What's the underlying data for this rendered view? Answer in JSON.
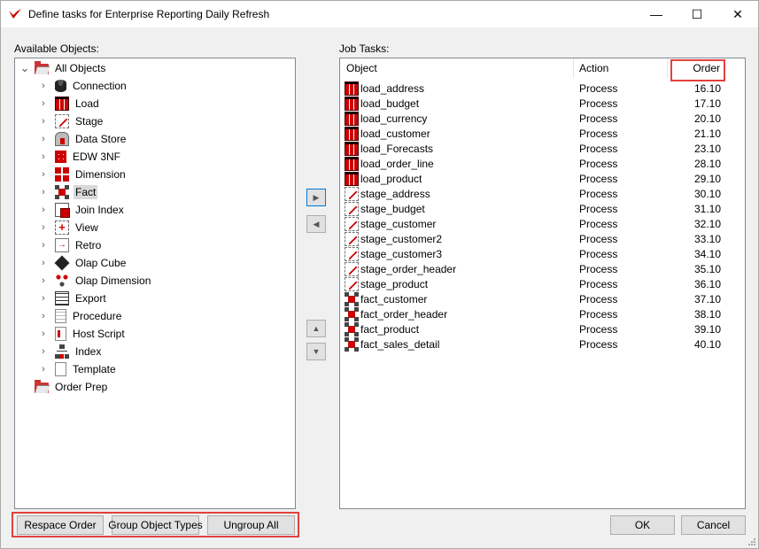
{
  "window": {
    "title": "Define tasks for Enterprise Reporting Daily Refresh",
    "minimize_glyph": "—",
    "maximize_glyph": "☐",
    "close_glyph": "✕"
  },
  "available": {
    "label": "Available Objects:",
    "root": {
      "label": "All Objects",
      "expander": "⌄",
      "icon": "folder-icon"
    },
    "items": [
      {
        "label": "Connection",
        "icon": "database-icon"
      },
      {
        "label": "Load",
        "icon": "load-table-icon"
      },
      {
        "label": "Stage",
        "icon": "stage-table-icon"
      },
      {
        "label": "Data Store",
        "icon": "data-store-icon"
      },
      {
        "label": "EDW 3NF",
        "icon": "edw-icon"
      },
      {
        "label": "Dimension",
        "icon": "dimension-icon"
      },
      {
        "label": "Fact",
        "icon": "fact-icon",
        "selected": true
      },
      {
        "label": "Join Index",
        "icon": "join-index-icon"
      },
      {
        "label": "View",
        "icon": "view-icon"
      },
      {
        "label": "Retro",
        "icon": "retro-icon"
      },
      {
        "label": "Olap Cube",
        "icon": "olap-cube-icon"
      },
      {
        "label": "Olap Dimension",
        "icon": "olap-dimension-icon"
      },
      {
        "label": "Export",
        "icon": "export-icon"
      },
      {
        "label": "Procedure",
        "icon": "procedure-icon"
      },
      {
        "label": "Host Script",
        "icon": "host-script-icon"
      },
      {
        "label": "Index",
        "icon": "index-icon"
      },
      {
        "label": "Template",
        "icon": "template-icon"
      }
    ],
    "order_prep": {
      "label": "Order Prep",
      "icon": "folder-icon"
    },
    "expander_glyph": "›"
  },
  "move_buttons": {
    "add_glyph": "▶",
    "remove_glyph": "◀",
    "up_glyph": "▲",
    "down_glyph": "▼"
  },
  "job": {
    "label": "Job Tasks:",
    "columns": {
      "object": "Object",
      "action": "Action",
      "order": "Order"
    },
    "rows": [
      {
        "object": "load_address",
        "action": "Process",
        "order": "16.10",
        "icon": "load-table-icon"
      },
      {
        "object": "load_budget",
        "action": "Process",
        "order": "17.10",
        "icon": "load-table-icon"
      },
      {
        "object": "load_currency",
        "action": "Process",
        "order": "20.10",
        "icon": "load-table-icon"
      },
      {
        "object": "load_customer",
        "action": "Process",
        "order": "21.10",
        "icon": "load-table-icon"
      },
      {
        "object": "load_Forecasts",
        "action": "Process",
        "order": "23.10",
        "icon": "load-table-icon"
      },
      {
        "object": "load_order_line",
        "action": "Process",
        "order": "28.10",
        "icon": "load-table-icon"
      },
      {
        "object": "load_product",
        "action": "Process",
        "order": "29.10",
        "icon": "load-table-icon"
      },
      {
        "object": "stage_address",
        "action": "Process",
        "order": "30.10",
        "icon": "stage-table-icon"
      },
      {
        "object": "stage_budget",
        "action": "Process",
        "order": "31.10",
        "icon": "stage-table-icon"
      },
      {
        "object": "stage_customer",
        "action": "Process",
        "order": "32.10",
        "icon": "stage-table-icon"
      },
      {
        "object": "stage_customer2",
        "action": "Process",
        "order": "33.10",
        "icon": "stage-table-icon"
      },
      {
        "object": "stage_customer3",
        "action": "Process",
        "order": "34.10",
        "icon": "stage-table-icon"
      },
      {
        "object": "stage_order_header",
        "action": "Process",
        "order": "35.10",
        "icon": "stage-table-icon"
      },
      {
        "object": "stage_product",
        "action": "Process",
        "order": "36.10",
        "icon": "stage-table-icon"
      },
      {
        "object": "fact_customer",
        "action": "Process",
        "order": "37.10",
        "icon": "fact-icon"
      },
      {
        "object": "fact_order_header",
        "action": "Process",
        "order": "38.10",
        "icon": "fact-icon"
      },
      {
        "object": "fact_product",
        "action": "Process",
        "order": "39.10",
        "icon": "fact-icon"
      },
      {
        "object": "fact_sales_detail",
        "action": "Process",
        "order": "40.10",
        "icon": "fact-icon"
      }
    ]
  },
  "bottom_buttons": {
    "respace": "Respace Order",
    "group": "Group Object Types",
    "ungroup": "Ungroup All",
    "ok": "OK",
    "cancel": "Cancel"
  },
  "colors": {
    "highlight": "#e0423f",
    "icon_red": "#cc0000"
  }
}
